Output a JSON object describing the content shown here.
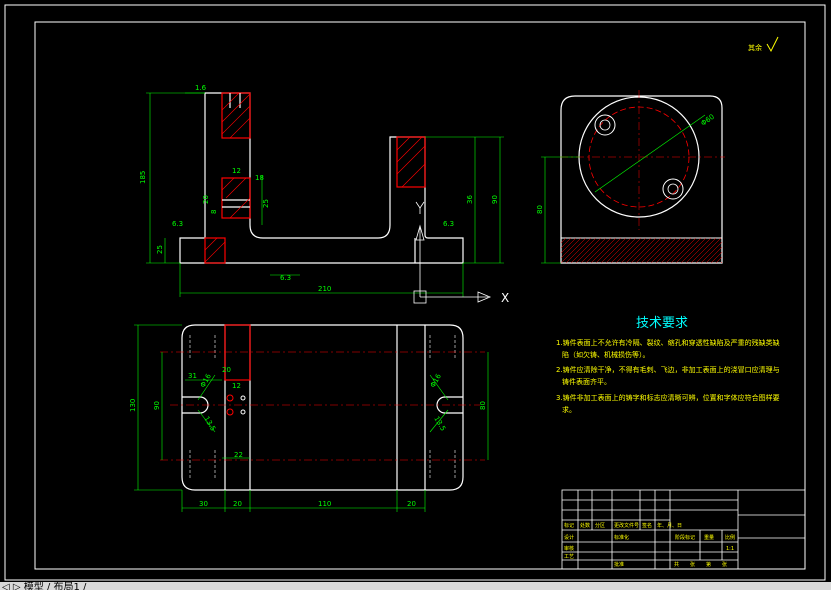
{
  "colors": {
    "background": "#000000",
    "frame": "#ffffff",
    "part": "#ffffff",
    "dimension": "#00ff00",
    "hatch": "#ff0000",
    "center": "#ff0000",
    "text": "#ffff00",
    "tech_title": "#00ffff"
  },
  "roughness_note": "其余",
  "tech_requirements": {
    "title": "技术要求",
    "items": [
      "1.铸件表面上不允许有冷隔、裂纹、缩孔和穿透性缺陷及严重的残缺类缺",
      "陷（如欠铸、机械损伤等）。",
      "2.铸件应清除干净，不得有毛刺、飞边，非加工表面上的浇冒口应清理与",
      "铸件表面齐平。",
      "3.铸件非加工表面上的铸字和标志应清晰可辨，位置和字体应符合图样要",
      "求。"
    ]
  },
  "dimensions": {
    "front": [
      "1.6",
      "185",
      "12",
      "20",
      "25",
      "18",
      "8",
      "6.3",
      "25",
      "6.3",
      "36",
      "90",
      "6.3",
      "210"
    ],
    "side": [
      "80",
      "Φ60"
    ],
    "top": [
      "130",
      "90",
      "31",
      "20",
      "12",
      "22",
      "30",
      "20",
      "110",
      "20",
      "Φ16",
      "Φ16",
      "13.5",
      "13.5",
      "80"
    ]
  },
  "axis_label": "X",
  "title_block": {
    "labels": [
      "标记",
      "处数",
      "分区",
      "更改文件号",
      "签名",
      "年、月、日",
      "设计",
      "标准化",
      "审核",
      "工艺",
      "批准",
      "阶段标记",
      "重量",
      "比例",
      "1:1",
      "共",
      "张",
      "第",
      "张"
    ]
  },
  "status_bar": "◁ ▷ 模型 / 布局1 /"
}
